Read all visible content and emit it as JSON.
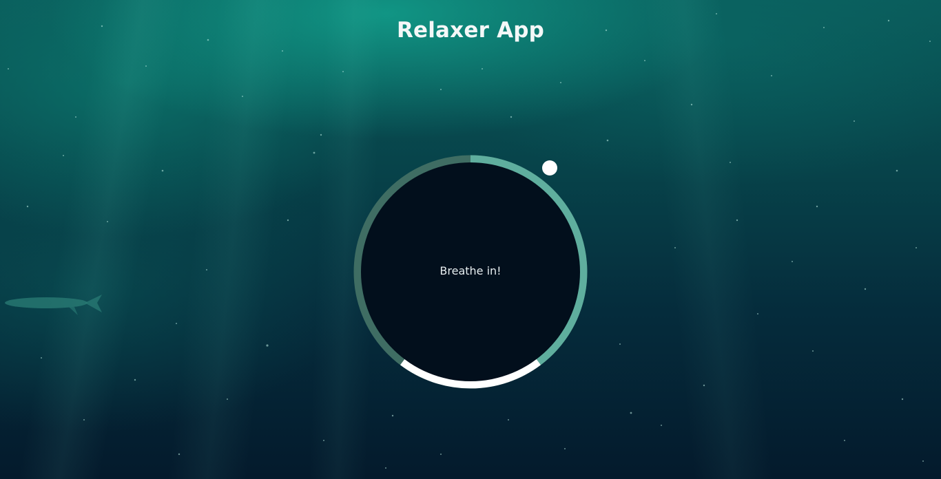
{
  "app": {
    "title": "Relaxer App"
  },
  "breathing": {
    "status_text": "Breathe in!",
    "ring_colors": {
      "inhale": "#5fae9e",
      "hold": "#ffffff",
      "exhale": "#3f6d63"
    },
    "pointer_color": "#ffffff",
    "inner_color": "#020f1c"
  },
  "icons": {
    "pointer": "circle-dot-icon"
  }
}
